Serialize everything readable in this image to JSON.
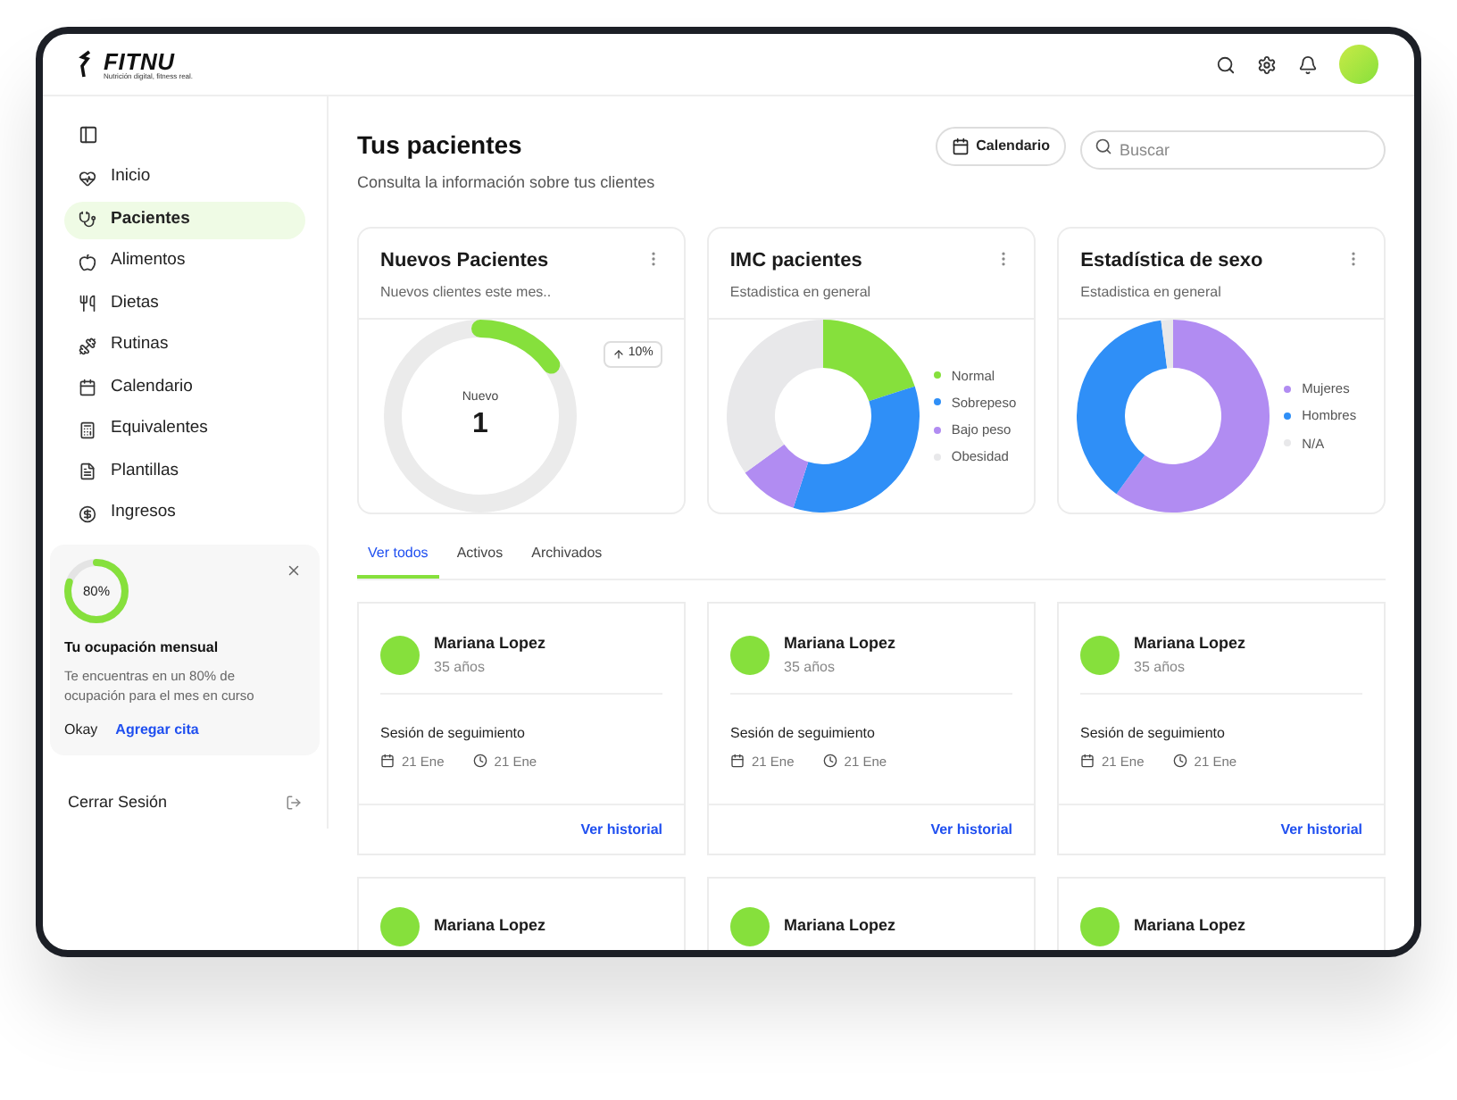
{
  "header": {
    "logo": "FITNU",
    "tagline": "Nutrición digital, fitness real."
  },
  "sidebar": {
    "items": [
      {
        "label": "Inicio",
        "selected": false
      },
      {
        "label": "Pacientes",
        "selected": true
      },
      {
        "label": "Alimentos",
        "selected": false
      },
      {
        "label": "Dietas",
        "selected": false
      },
      {
        "label": "Rutinas",
        "selected": false
      },
      {
        "label": "Calendario",
        "selected": false
      },
      {
        "label": "Equivalentes",
        "selected": false
      },
      {
        "label": "Plantillas",
        "selected": false
      },
      {
        "label": "Ingresos",
        "selected": false
      }
    ],
    "occupancy": {
      "level": 0.8,
      "percent": "80%",
      "title": "Tu ocupación mensual",
      "text": "Te encuentras en un 80% de ocupación para el mes en curso",
      "actions": [
        "Okay",
        "Agregar cita"
      ]
    },
    "logout": "Cerrar Sesión"
  },
  "main": {
    "title": "Tus pacientes",
    "subtitle": "Consulta la información sobre tus clientes",
    "calendar_button": "Calendario",
    "search": {
      "placeholder": "Buscar"
    },
    "stat_cards": [
      {
        "kind": "gauge",
        "title": "Nuevos Pacientes",
        "subtitle": "Nuevos clientes este mes..",
        "badge": "10%",
        "center_label": "Nuevo",
        "center_value": "1",
        "level": 0.15
      },
      {
        "kind": "donut",
        "title": "IMC pacientes",
        "subtitle": "Estadistica en general",
        "legend": [
          {
            "label": "Normal",
            "color": "#86e03c"
          },
          {
            "label": "Sobrepeso",
            "color": "#2f8ff7"
          },
          {
            "label": "Bajo peso",
            "color": "#b18cf2"
          },
          {
            "label": "Obesidad",
            "color": "#e8e8ea"
          }
        ]
      },
      {
        "kind": "donut",
        "title": "Estadística de sexo",
        "subtitle": "Estadistica en general",
        "legend": [
          {
            "label": "Mujeres",
            "color": "#b18cf2"
          },
          {
            "label": "Hombres",
            "color": "#2f8ff7"
          },
          {
            "label": "N/A",
            "color": "#e8e8ea"
          }
        ]
      }
    ],
    "tabs": [
      {
        "label": "Ver todos",
        "selected": true
      },
      {
        "label": "Activos",
        "selected": false
      },
      {
        "label": "Archivados",
        "selected": false
      }
    ],
    "patients": [
      {
        "name": "Mariana Lopez",
        "age": "35 años",
        "session": "Sesión de seguimiento",
        "date": "21 Ene",
        "time": "21 Ene",
        "link": "Ver historial"
      },
      {
        "name": "Mariana Lopez",
        "age": "35 años",
        "session": "Sesión de seguimiento",
        "date": "21 Ene",
        "time": "21 Ene",
        "link": "Ver historial"
      },
      {
        "name": "Mariana Lopez",
        "age": "35 años",
        "session": "Sesión de seguimiento",
        "date": "21 Ene",
        "time": "21 Ene",
        "link": "Ver historial"
      },
      {
        "name": "Mariana Lopez"
      },
      {
        "name": "Mariana Lopez"
      },
      {
        "name": "Mariana Lopez"
      }
    ]
  }
}
